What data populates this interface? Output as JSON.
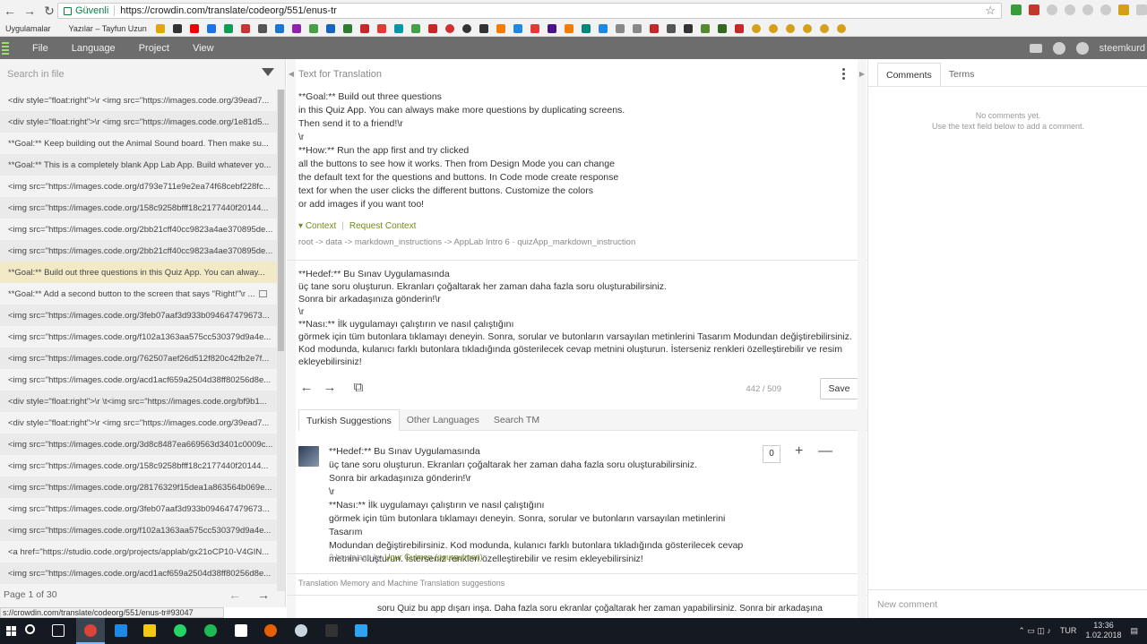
{
  "browser": {
    "secure_label": "Güvenli",
    "url": "https://crowdin.com/translate/codeorg/551/enus-tr",
    "bookmarks_label": "Uygulamalar",
    "bookmark_2": "Yazılar – Tayfun Uzun"
  },
  "app_menu": {
    "file": "File",
    "language": "Language",
    "project": "Project",
    "view": "View",
    "user": "steemkurd"
  },
  "left": {
    "search_placeholder": "Search in file",
    "rows": [
      "<div style=\"float:right\">\\r <img src=\"https://images.code.org/39ead7...",
      "<div style=\"float:right\">\\r <img src=\"https://images.code.org/1e81d5...",
      "**Goal:** Keep building out the Animal Sound board. Then make su...",
      "**Goal:** This is a completely blank App Lab App. Build whatever yo...",
      "<img src=\"https://images.code.org/d793e711e9e2ea74f68cebf228fc...",
      "<img src=\"https://images.code.org/158c9258bfff18c2177440f20144...",
      "<img src=\"https://images.code.org/2bb21cff40cc9823a4ae370895de...",
      "<img src=\"https://images.code.org/2bb21cff40cc9823a4ae370895de...",
      "**Goal:** Build out three questions in this Quiz App. You can alway...",
      "**Goal:** Add a second button to the screen that says \"Right!\"\\r ...",
      "<img src=\"https://images.code.org/3feb07aaf3d933b094647479673...",
      "<img src=\"https://images.code.org/f102a1363aa575cc530379d9a4e...",
      "<img src=\"https://images.code.org/762507aef26d512f820c42fb2e7f...",
      "<img src=\"https://images.code.org/acd1acf659a2504d38ff80256d8e...",
      "<div style=\"float:right\">\\r \\t<img src=\"https://images.code.org/bf9b1...",
      "<div style=\"float:right\">\\r <img src=\"https://images.code.org/39ead7...",
      "<img src=\"https://images.code.org/3d8c8487ea669563d3401c0009c...",
      "<img src=\"https://images.code.org/158c9258bfff18c2177440f20144...",
      "<img src=\"https://images.code.org/28176329f15dea1a863564b069e...",
      "<img src=\"https://images.code.org/3feb07aaf3d933b094647479673...",
      "<img src=\"https://images.code.org/f102a1363aa575cc530379d9a4e...",
      "<a href=\"https://studio.code.org/projects/applab/gx21oCP10-V4GIN...",
      "<img src=\"https://images.code.org/acd1acf659a2504d38ff80256d8e..."
    ],
    "pager": "Page 1 of 30",
    "status_url": "s://crowdin.com/translate/codeorg/551/enus-tr#93047"
  },
  "middle": {
    "title": "Text for Translation",
    "source_lines": [
      "**Goal:** Build out three questions",
      "in this Quiz App. You can always make more questions by duplicating screens.",
      "Then send it to a friend!\\r",
      "\\r",
      "**How:** Run the app first and try clicked",
      "all the buttons to see how it works. Then from Design Mode you can change",
      "the default text for the questions and buttons. In Code mode create response",
      "text for when the user clicks the different buttons. Customize the colors",
      "or add images if you want too!"
    ],
    "context_label": "Context",
    "request_context": "Request Context",
    "breadcrumb": "root -> data -> markdown_instructions -> AppLab Intro 6 · quizApp_markdown_instruction",
    "target_lines": [
      "**Hedef:** Bu Sınav Uygulamasında",
      "üç tane soru oluşturun. Ekranları çoğaltarak her zaman daha fazla soru oluşturabilirsiniz.",
      "Sonra bir arkadaşınıza gönderin!\\r",
      "\\r",
      "**Nası:** İlk uygulamayı çalıştırın ve nasıl çalıştığını",
      "görmek için tüm butonlara tıklamayı deneyin. Sonra, sorular ve butonların varsayılan metinlerini Tasarım Modundan değiştirebilirsiniz. Kod modunda, kulanıcı farklı butonlara tıkladığında gösterilecek cevap metnini oluşturun. İsterseniz renkleri özelleştirebilir ve resim ekleyebilirsiniz!"
    ],
    "counter": "442 / 509",
    "save": "Save",
    "tabs": [
      "Turkish Suggestions",
      "Other Languages",
      "Search TM"
    ],
    "suggestion_lines": [
      "**Hedef:** Bu Sınav Uygulamasında",
      "üç tane soru oluşturun. Ekranları çoğaltarak her zaman daha fazla soru oluşturabilirsiniz.",
      "Sonra bir arkadaşınıza gönderin!\\r",
      "\\r",
      "**Nası:** İlk uygulamayı çalıştırın ve nasıl çalıştığını",
      "görmek için tüm butonlara tıklamayı deneyin. Sonra, sorular ve butonların varsayılan metinlerini Tasarım",
      "Modundan değiştirebilirsiniz. Kod modunda, kulanıcı farklı butonlara tıkladığında gösterilecek cevap",
      "metnini oluşturun. İsterseniz renkleri özelleştirebilir ve resim ekleyebilirsiniz!"
    ],
    "suggestion_time": "2 hours ago by",
    "suggestion_author": "Ugur Gulmen (ugurgulmen)",
    "vote_count": "0",
    "tm_label": "Translation Memory and Machine Translation suggestions",
    "tm_text": "soru Quiz bu app dışarı inşa. Daha fazla soru ekranlar çoğaltarak her zaman yapabilirsiniz. Sonra bir arkadaşına"
  },
  "right": {
    "tab_comments": "Comments",
    "tab_terms": "Terms",
    "no_comments": "No comments yet.",
    "hint": "Use the text field below to add a comment.",
    "new_comment": "New comment"
  },
  "taskbar": {
    "lang": "TUR",
    "time": "13:36",
    "date": "1.02.2018"
  }
}
